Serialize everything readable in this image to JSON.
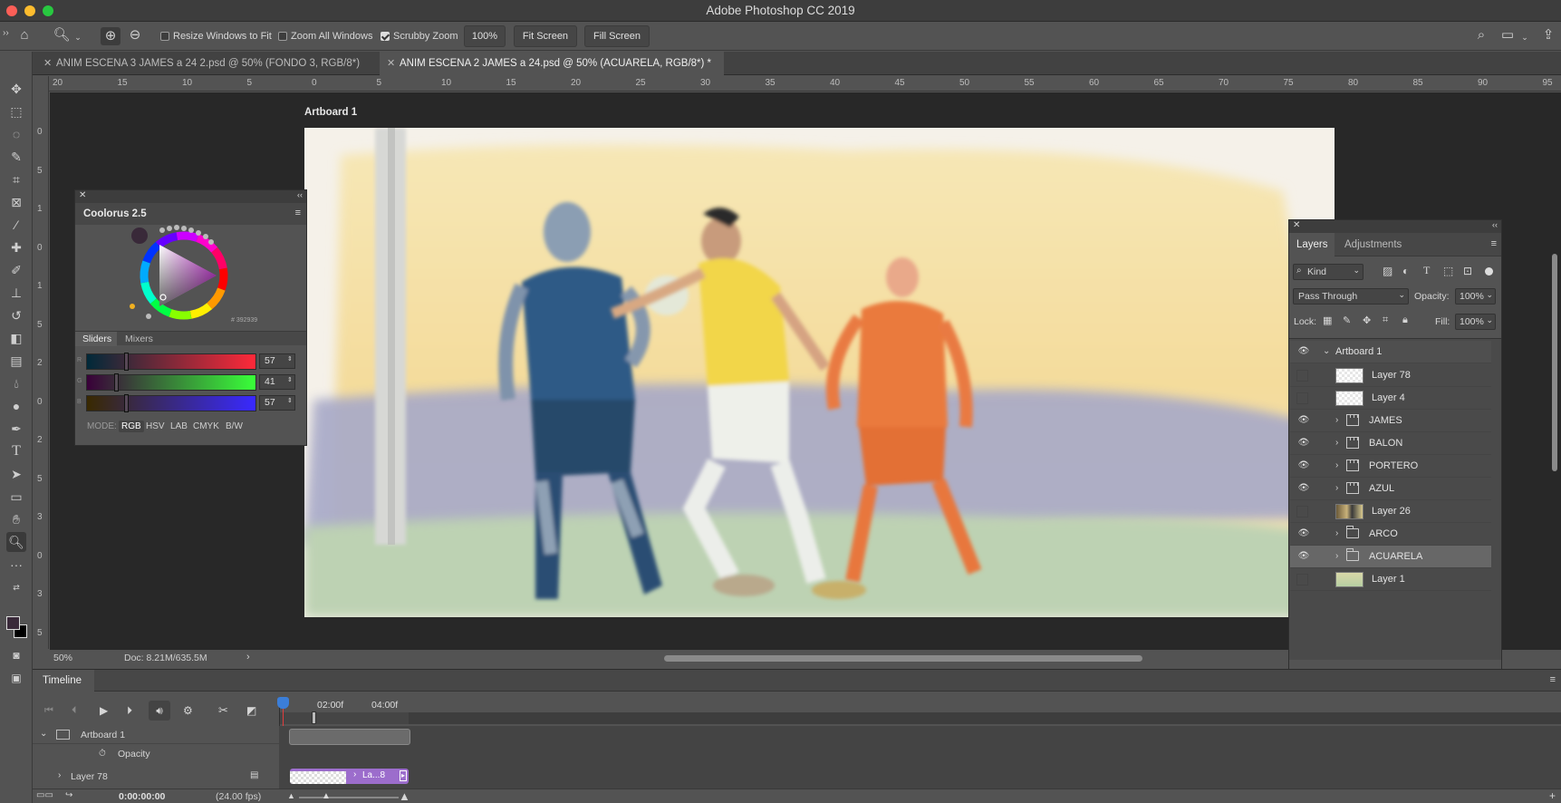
{
  "app": {
    "title": "Adobe Photoshop CC 2019"
  },
  "options": {
    "resize_windows": "Resize Windows to Fit",
    "zoom_all": "Zoom All Windows",
    "scrubby_zoom": "Scrubby Zoom",
    "zoom_value": "100%",
    "fit_screen": "Fit Screen",
    "fill_screen": "Fill Screen"
  },
  "tabs": [
    {
      "label": "ANIM ESCENA 3 JAMES a 24 2.psd @ 50% (FONDO 3, RGB/8*)",
      "active": false
    },
    {
      "label": "ANIM ESCENA 2 JAMES a 24.psd @ 50% (ACUARELA, RGB/8*) *",
      "active": true
    }
  ],
  "ruler": {
    "h": [
      "20",
      "15",
      "10",
      "5",
      "0",
      "5",
      "10",
      "15",
      "20",
      "25",
      "30",
      "35",
      "40",
      "45",
      "50",
      "55",
      "60",
      "65",
      "70",
      "75",
      "80",
      "85",
      "90",
      "95"
    ],
    "v": [
      "0",
      "5",
      "1",
      "0",
      "1",
      "5",
      "2",
      "0",
      "2",
      "5",
      "3",
      "0",
      "3",
      "5",
      "4"
    ]
  },
  "canvas": {
    "artboard_label": "Artboard 1"
  },
  "status": {
    "zoom": "50%",
    "doc": "Doc: 8.21M/635.5M"
  },
  "coolorus": {
    "title": "Coolorus 2.5",
    "tabs": [
      "Sliders",
      "Mixers"
    ],
    "sliders": [
      {
        "channel": "R",
        "value": "57",
        "pos": 0.22
      },
      {
        "channel": "G",
        "value": "41",
        "pos": 0.16
      },
      {
        "channel": "B",
        "value": "57",
        "pos": 0.22
      }
    ],
    "mode_label": "MODE:",
    "modes": [
      "RGB",
      "HSV",
      "LAB",
      "CMYK",
      "B/W"
    ],
    "hex": "# 392939",
    "colors": {
      "current": "#392939"
    }
  },
  "layers_panel": {
    "tabs": [
      "Layers",
      "Adjustments"
    ],
    "filter": "Kind",
    "blend_mode": "Pass Through",
    "opacity_label": "Opacity:",
    "opacity": "100%",
    "lock_label": "Lock:",
    "fill_label": "Fill:",
    "fill": "100%",
    "layers": [
      {
        "name": "Artboard 1",
        "type": "artboard",
        "visible": true
      },
      {
        "name": "Layer 78",
        "type": "layer",
        "visible": false
      },
      {
        "name": "Layer 4",
        "type": "layer",
        "visible": false
      },
      {
        "name": "JAMES",
        "type": "video-group",
        "visible": true
      },
      {
        "name": "BALON",
        "type": "video-group",
        "visible": true
      },
      {
        "name": "PORTERO",
        "type": "video-group",
        "visible": true
      },
      {
        "name": "AZUL",
        "type": "video-group",
        "visible": true
      },
      {
        "name": "Layer 26",
        "type": "layer",
        "visible": false
      },
      {
        "name": "ARCO",
        "type": "group",
        "visible": true
      },
      {
        "name": "ACUARELA",
        "type": "group",
        "visible": true,
        "selected": true
      },
      {
        "name": "Layer 1",
        "type": "layer",
        "visible": false
      }
    ]
  },
  "timeline": {
    "title": "Timeline",
    "markers": [
      "02:00f",
      "04:00f"
    ],
    "tracks": [
      {
        "name": "Artboard 1"
      },
      {
        "name": "Opacity"
      },
      {
        "name": "Layer 78"
      }
    ],
    "clip_label": "La...8",
    "timecode": "0:00:00:00",
    "fps": "(24.00 fps)"
  }
}
